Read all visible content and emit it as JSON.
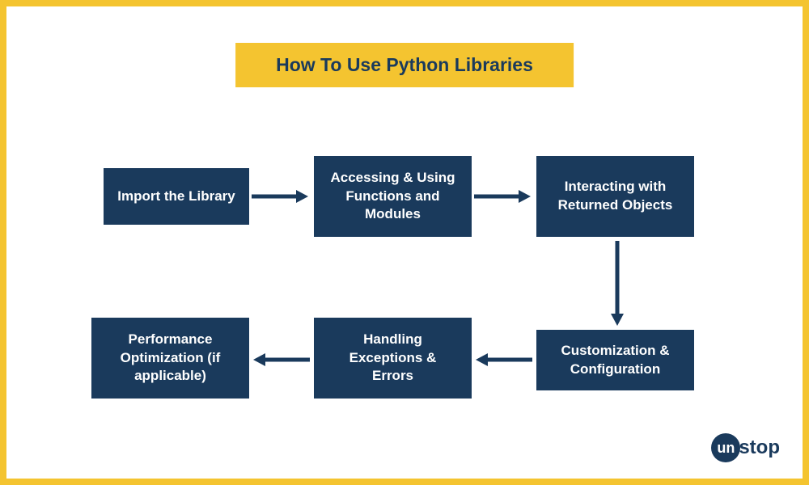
{
  "title": "How To Use Python Libraries",
  "steps": {
    "s1": "Import the Library",
    "s2": "Accessing & Using Functions and Modules",
    "s3": "Interacting with Returned Objects",
    "s4": "Customization & Configuration",
    "s5": "Handling Exceptions & Errors",
    "s6": "Performance Optimization (if applicable)"
  },
  "logo": {
    "circle_text": "un",
    "rest_text": "stop"
  },
  "colors": {
    "border": "#f4c430",
    "box_bg": "#1a3a5c",
    "box_text": "#ffffff",
    "title_bg": "#f4c430",
    "title_text": "#1a3a5c",
    "arrow": "#1a3a5c"
  }
}
